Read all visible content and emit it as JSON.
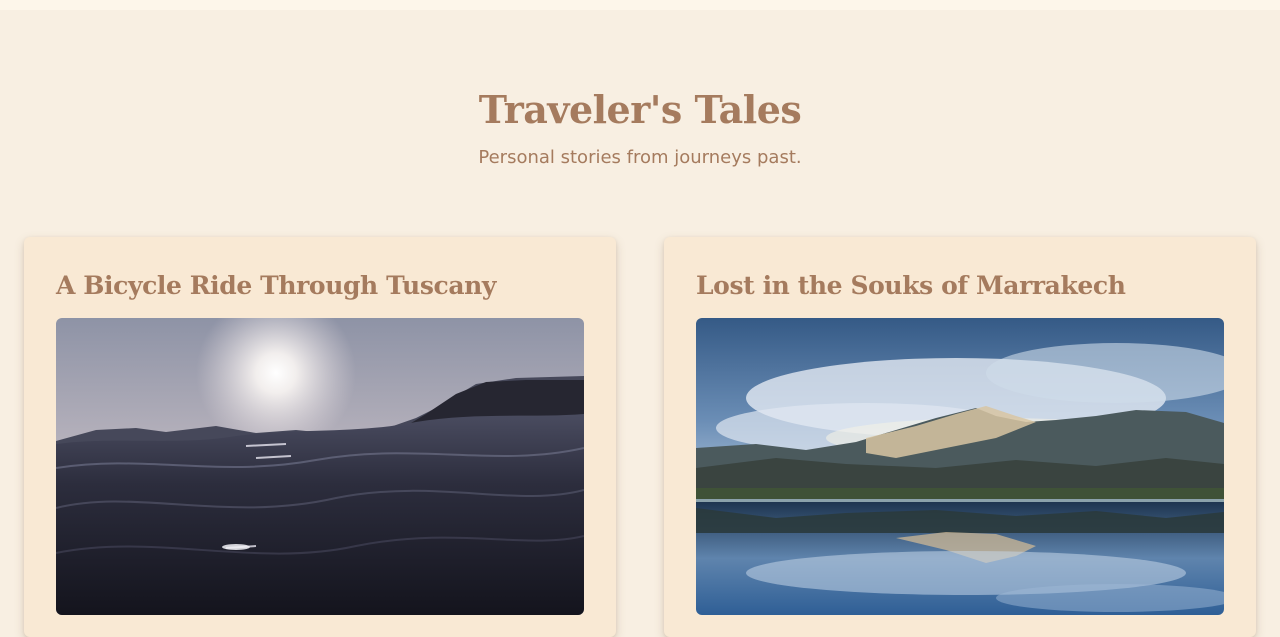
{
  "header": {
    "title": "Traveler's Tales",
    "subtitle": "Personal stories from journeys past."
  },
  "posts": [
    {
      "title": "A Bicycle Ride Through Tuscany",
      "image": "ocean-sunset-waves-photo"
    },
    {
      "title": "Lost in the Souks of Marrakech",
      "image": "mountain-lake-reflection-photo"
    }
  ],
  "colors": {
    "page_background": "#f8efe2",
    "card_background": "#f9e9d4",
    "accent_text": "#a57b5e"
  }
}
